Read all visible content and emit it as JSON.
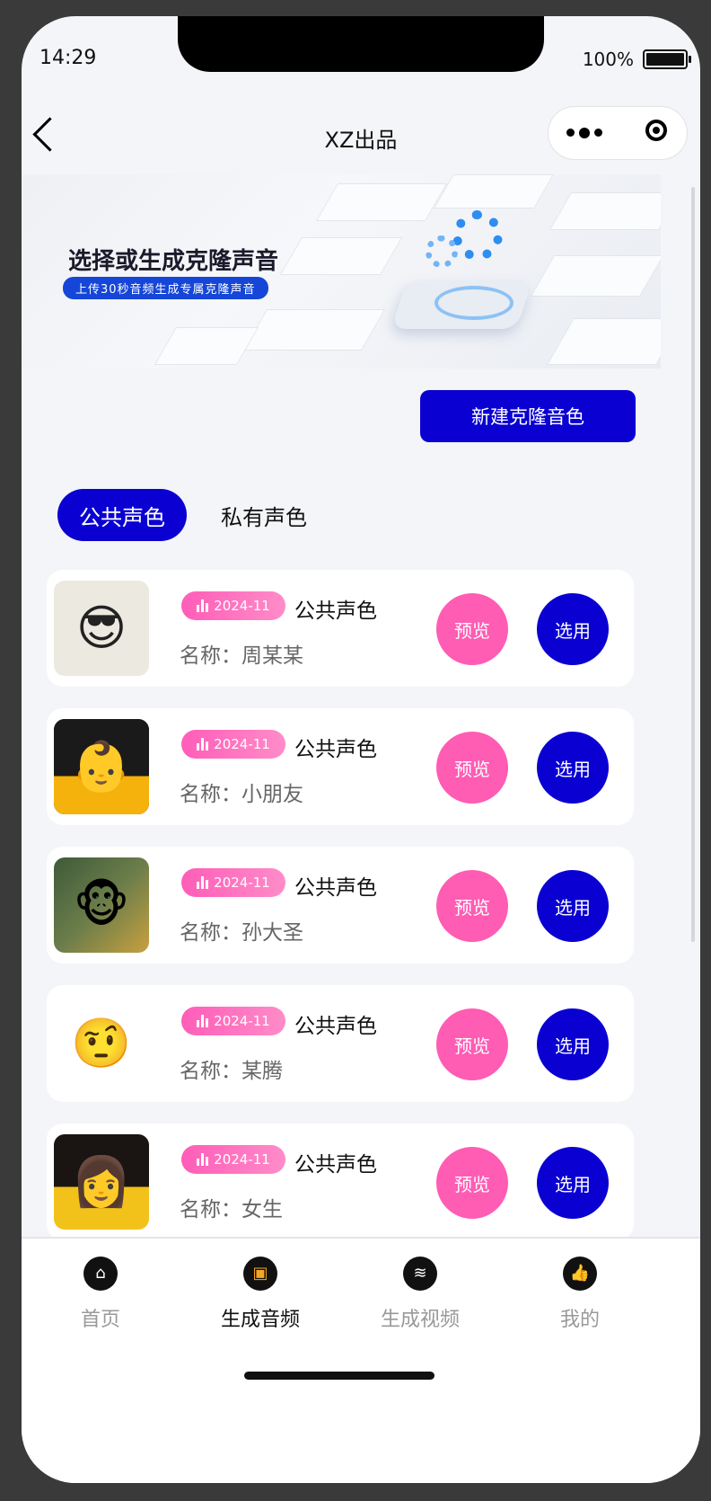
{
  "status": {
    "time": "14:29",
    "battery": "100%"
  },
  "nav": {
    "title": "XZ出品"
  },
  "banner": {
    "title": "选择或生成克隆声音",
    "subtitle": "上传30秒音频生成专属克隆声音"
  },
  "actions": {
    "new_voice": "新建克隆音色"
  },
  "tabs": [
    {
      "label": "公共声色",
      "active": true
    },
    {
      "label": "私有声色",
      "active": false
    }
  ],
  "voices": [
    {
      "date": "2024-11",
      "type": "公共声色",
      "name": "名称：周某某",
      "preview": "预览",
      "use": "选用"
    },
    {
      "date": "2024-11",
      "type": "公共声色",
      "name": "名称：小朋友",
      "preview": "预览",
      "use": "选用"
    },
    {
      "date": "2024-11",
      "type": "公共声色",
      "name": "名称：孙大圣",
      "preview": "预览",
      "use": "选用"
    },
    {
      "date": "2024-11",
      "type": "公共声色",
      "name": "名称：某腾",
      "preview": "预览",
      "use": "选用"
    },
    {
      "date": "2024-11",
      "type": "公共声色",
      "name": "名称：女生",
      "preview": "预览",
      "use": "选用"
    }
  ],
  "tabbar": [
    {
      "label": "首页",
      "icon": "home-icon"
    },
    {
      "label": "生成音频",
      "icon": "audio-icon"
    },
    {
      "label": "生成视频",
      "icon": "layers-icon"
    },
    {
      "label": "我的",
      "icon": "thumbs-up-icon"
    }
  ],
  "colors": {
    "primary": "#0a00d2",
    "accent": "#ff5cb4",
    "background": "#f4f5f8"
  }
}
